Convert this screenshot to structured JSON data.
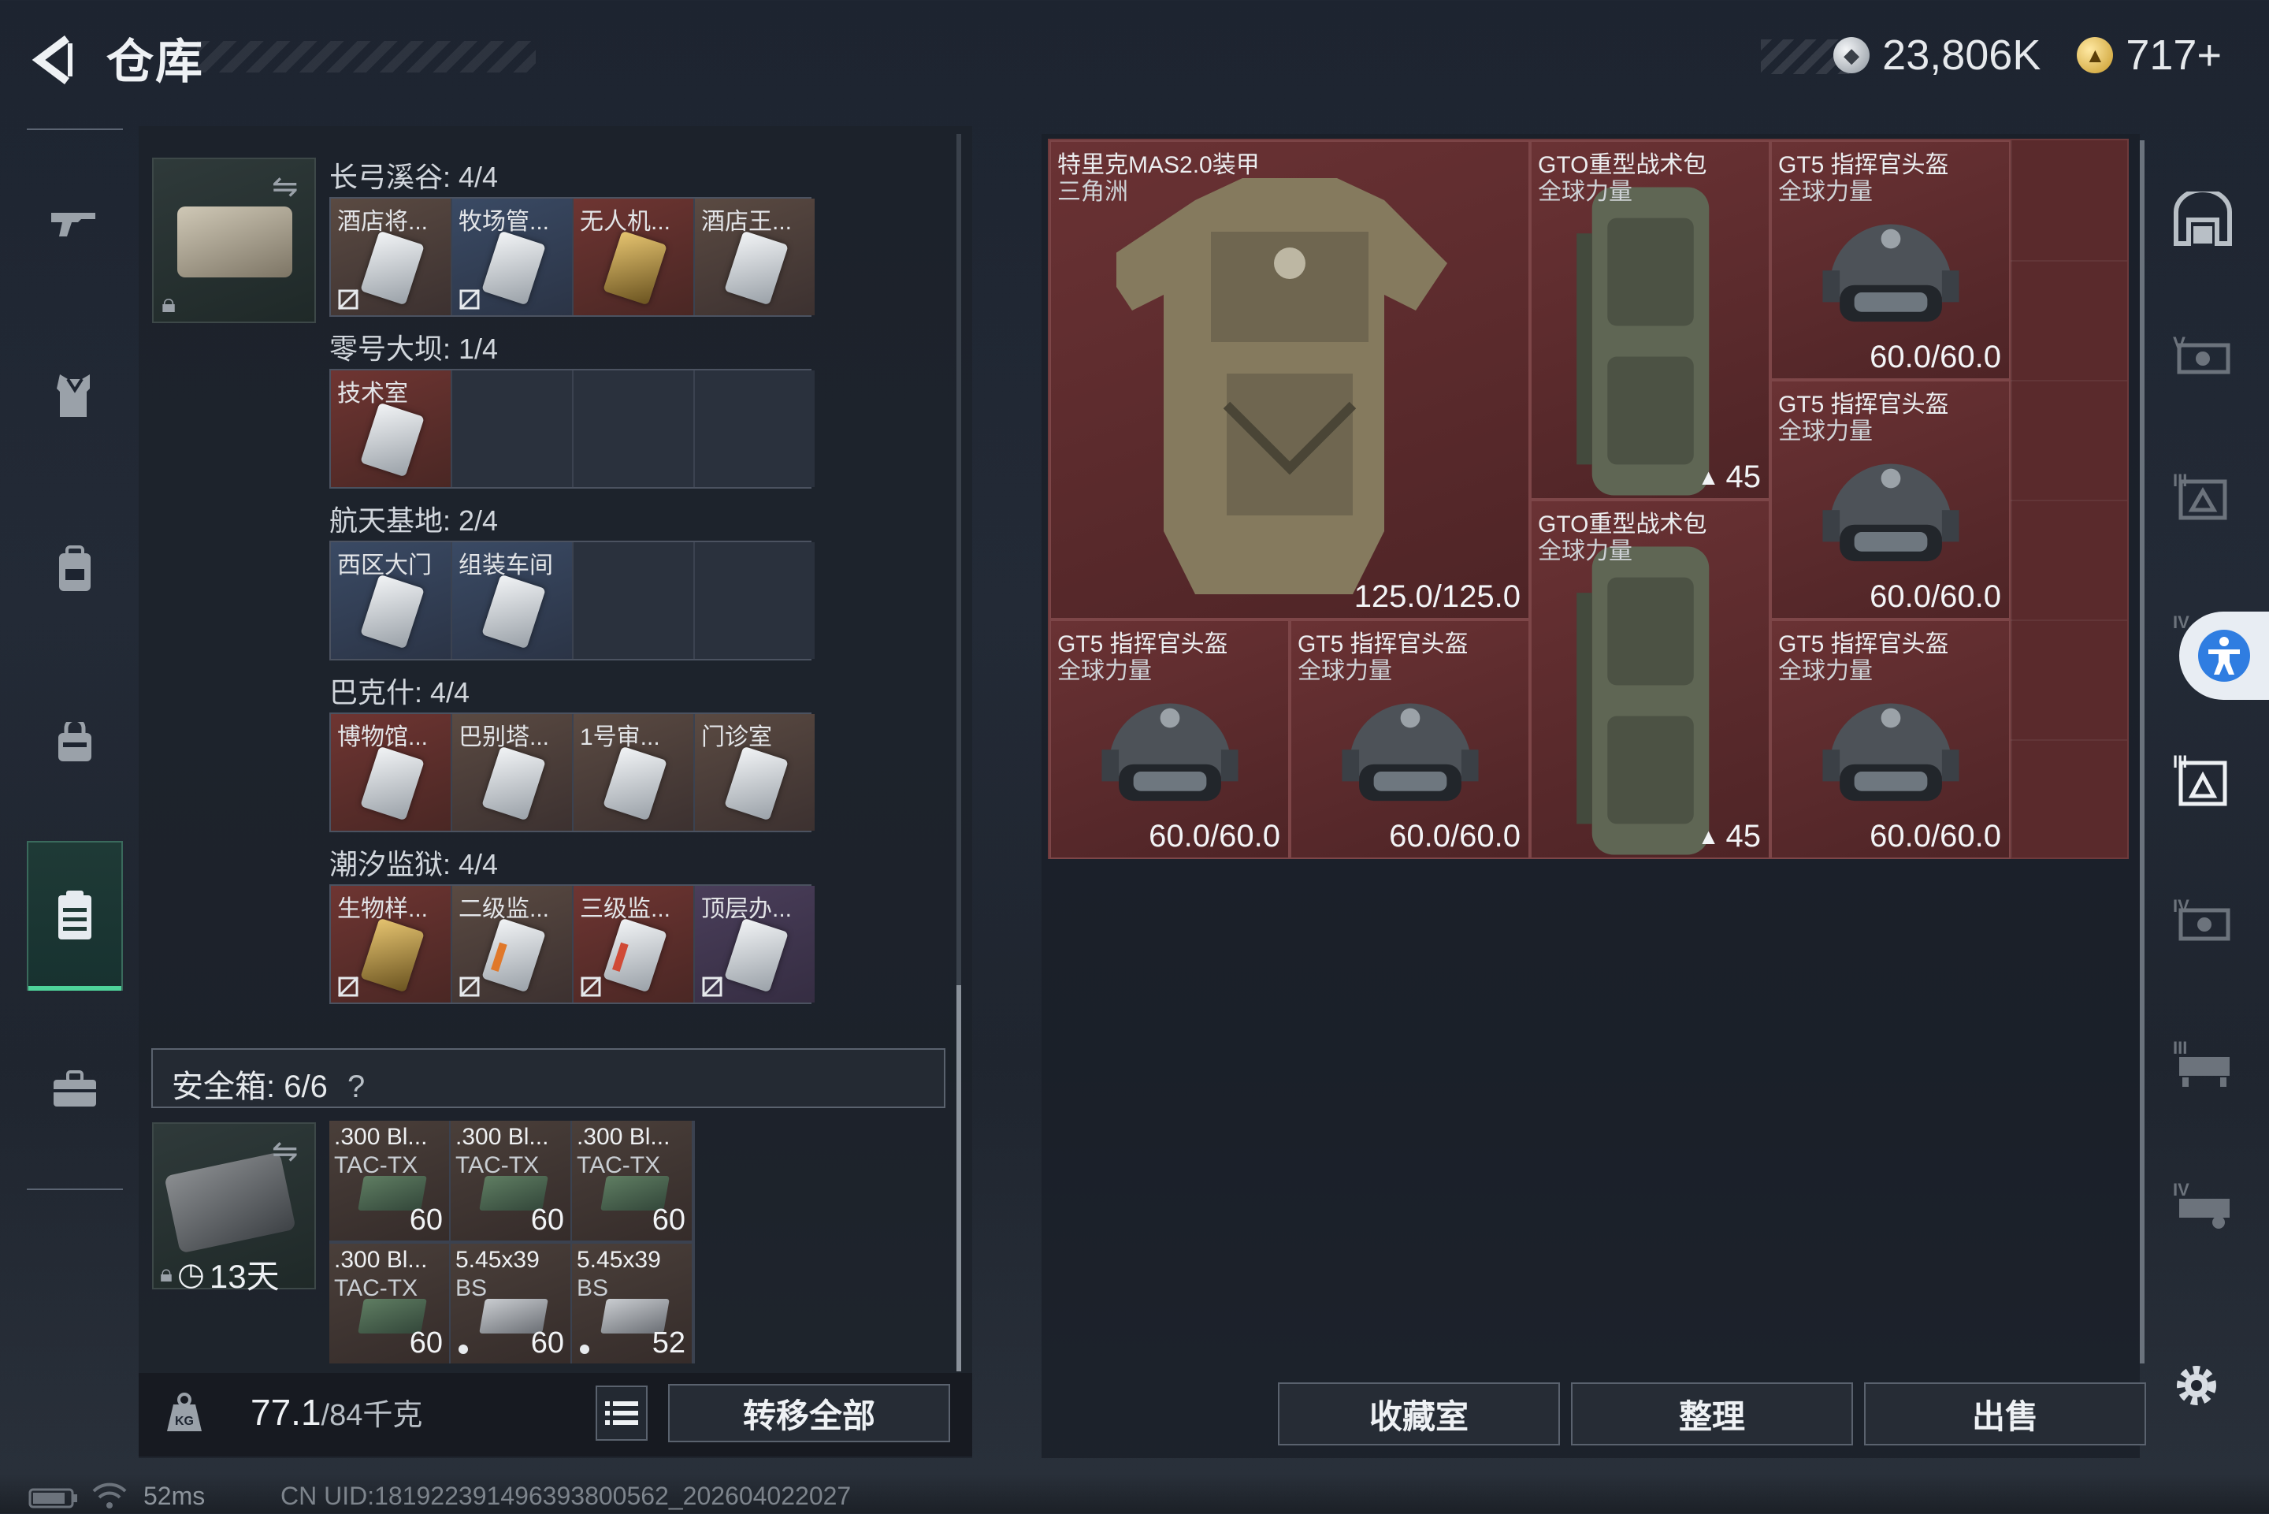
{
  "header": {
    "title": "仓库",
    "silver": "23,806K",
    "gold": "717+"
  },
  "left_nav": [
    "gun-icon",
    "vest-icon",
    "backpack-icon",
    "pouch-icon",
    "keycard-case-icon",
    "briefcase-icon"
  ],
  "key_case": {
    "maps": [
      {
        "name": "长弓溪谷: 4/4",
        "cells": [
          {
            "label": "酒店将...",
            "color": "brown",
            "card": "white",
            "tag": true
          },
          {
            "label": "牧场管...",
            "color": "blue",
            "card": "white",
            "tag": true
          },
          {
            "label": "无人机...",
            "color": "red",
            "card": "gold",
            "tag": false
          },
          {
            "label": "酒店王...",
            "color": "brown",
            "card": "white",
            "tag": false
          }
        ]
      },
      {
        "name": "零号大坝: 1/4",
        "cells": [
          {
            "label": "技术室",
            "color": "red",
            "card": "white",
            "tag": false
          },
          {
            "label": "",
            "color": "empty"
          },
          {
            "label": "",
            "color": "empty"
          },
          {
            "label": "",
            "color": "empty"
          }
        ]
      },
      {
        "name": "航天基地: 2/4",
        "cells": [
          {
            "label": "西区大门",
            "color": "blue",
            "card": "white",
            "tag": false
          },
          {
            "label": "组装车间",
            "color": "blue",
            "card": "white",
            "tag": false
          },
          {
            "label": "",
            "color": "empty"
          },
          {
            "label": "",
            "color": "empty"
          }
        ]
      },
      {
        "name": "巴克什: 4/4",
        "cells": [
          {
            "label": "博物馆...",
            "color": "red",
            "card": "white",
            "tag": false
          },
          {
            "label": "巴别塔...",
            "color": "brown",
            "card": "white",
            "tag": false
          },
          {
            "label": "1号审...",
            "color": "brown",
            "card": "white",
            "tag": false
          },
          {
            "label": "门诊室",
            "color": "brown",
            "card": "white",
            "tag": false
          }
        ]
      },
      {
        "name": "潮汐监狱: 4/4",
        "cells": [
          {
            "label": "生物样...",
            "color": "red",
            "card": "gold",
            "tag": true
          },
          {
            "label": "二级监...",
            "color": "brown",
            "card": "orange",
            "tag": true
          },
          {
            "label": "三级监...",
            "color": "red",
            "card": "redstripe",
            "tag": true
          },
          {
            "label": "顶层办...",
            "color": "purple",
            "card": "white",
            "tag": true
          }
        ]
      }
    ]
  },
  "safebox": {
    "label": "安全箱: 6/6",
    "help": "?",
    "timer": "13天",
    "ammo": [
      {
        "l1": ".300 Bl...",
        "l2": "TAC-TX",
        "qty": "60",
        "box": "green",
        "dot": false
      },
      {
        "l1": ".300 Bl...",
        "l2": "TAC-TX",
        "qty": "60",
        "box": "green",
        "dot": false
      },
      {
        "l1": ".300 Bl...",
        "l2": "TAC-TX",
        "qty": "60",
        "box": "green",
        "dot": false
      },
      {
        "l1": ".300 Bl...",
        "l2": "TAC-TX",
        "qty": "60",
        "box": "green",
        "dot": false
      },
      {
        "l1": "5.45x39",
        "l2": "BS",
        "qty": "60",
        "box": "grey",
        "dot": true
      },
      {
        "l1": "5.45x39",
        "l2": "BS",
        "qty": "52",
        "box": "grey",
        "dot": true
      }
    ]
  },
  "footer_left": {
    "weight": "77.1",
    "weight_max": "/84千克",
    "transfer_label": "转移全部"
  },
  "stash_items": [
    {
      "id": "vest",
      "n1": "特里克MAS2.0装甲",
      "n2": "三角洲",
      "value": "125.0/125.0",
      "kind": "vest"
    },
    {
      "id": "pack1",
      "n1": "GTO重型战术包",
      "n2": "全球力量",
      "value": "45",
      "kind": "pack"
    },
    {
      "id": "pack2",
      "n1": "GTO重型战术包",
      "n2": "全球力量",
      "value": "45",
      "kind": "pack"
    },
    {
      "id": "helm1",
      "n1": "GT5 指挥官头盔",
      "n2": "全球力量",
      "value": "60.0/60.0",
      "kind": "helmet"
    },
    {
      "id": "helm2",
      "n1": "GT5 指挥官头盔",
      "n2": "全球力量",
      "value": "60.0/60.0",
      "kind": "helmet"
    },
    {
      "id": "helm3",
      "n1": "GT5 指挥官头盔",
      "n2": "全球力量",
      "value": "60.0/60.0",
      "kind": "helmet"
    },
    {
      "id": "helm4",
      "n1": "GT5 指挥官头盔",
      "n2": "全球力量",
      "value": "60.0/60.0",
      "kind": "helmet"
    },
    {
      "id": "helm5",
      "n1": "GT5 指挥官头盔",
      "n2": "全球力量",
      "value": "60.0/60.0",
      "kind": "helmet"
    }
  ],
  "actions": {
    "collection": "收藏室",
    "sort": "整理",
    "sell": "出售"
  },
  "status": {
    "ping": "52ms",
    "uid": "CN UID:1819223914963938005​62_202604022027"
  },
  "colors": {
    "accent_green": "#4ed39a",
    "stash_red": "#5a2a2c",
    "highlight_blue": "#2f7de1"
  }
}
